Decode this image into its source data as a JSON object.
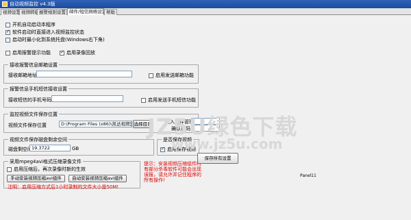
{
  "window": {
    "title": "自动视频监控 v4.3版"
  },
  "tabs": [
    "视频设置",
    "视频转码",
    "报警规则设置",
    "邮件/短信网络设置",
    "帮助"
  ],
  "general": {
    "autostart_label": "开机自动启动本程序",
    "autostart_checked": false,
    "auto_monitor_label": "软件启动时直接进入视频监控状态",
    "auto_monitor_checked": true,
    "minimize_label": "启动时最小化到系统托盘(Windows右下角)",
    "minimize_checked": false,
    "alarm_voice_label": "启用报警提示功能",
    "alarm_voice_checked": false,
    "playback_label": "启用录像回放",
    "playback_checked": true
  },
  "email": {
    "group_title": "接收报警信息邮箱设置",
    "address_label": "接收邮箱地址:",
    "address_value": "",
    "enable_label": "启用发送邮箱功能",
    "enable_checked": false
  },
  "sms": {
    "group_title": "报警信息手机短信接收设置",
    "phone_label": "接收短信的手机号码:",
    "phone_value": "",
    "enable_label": "启用发送手机短信功能",
    "enable_checked": false
  },
  "storage": {
    "group_title": "监控视频文件保存位置",
    "path_label": "视频文件保存位置",
    "path_value": "D:\\Program Files (x86)\\凯达视频监控录像软件\\av",
    "browse_label": "选择目录",
    "password_label": "进入软件管理密码",
    "confirm_label": "确认密码",
    "password_value": "",
    "confirm_value": ""
  },
  "disk": {
    "group_title": "视频文件保存磁盘剩余空间",
    "free_label": "磁盘剩空间",
    "free_value": "19.3722",
    "unit": "GB"
  },
  "save_video": {
    "group_title": "是否保存视频",
    "enable_label": "启用保存视频",
    "enable_checked": true
  },
  "mpeg": {
    "group_title": "采用mpeg4avi格式压缩录像文件",
    "compress_label": "启用压缩后，再次录像时新的生效",
    "compress_checked": false,
    "manual_button": "手动安装视频压缩avi组件",
    "auto_button": "自动安装视频压缩avi组件",
    "note": "注明：启用压缩方式后1小时录制的文件大小是50M!"
  },
  "tip": {
    "text": "提示：安装视频压缩组件时有部分杀毒软件可能会出现误报，请允许并记住程序的所有操作!"
  },
  "save_button": "保存所有设置",
  "panel_label": "Panel11",
  "watermark": {
    "main": "JZ5U绿色下载",
    "sub": "www.jz5u.com"
  }
}
